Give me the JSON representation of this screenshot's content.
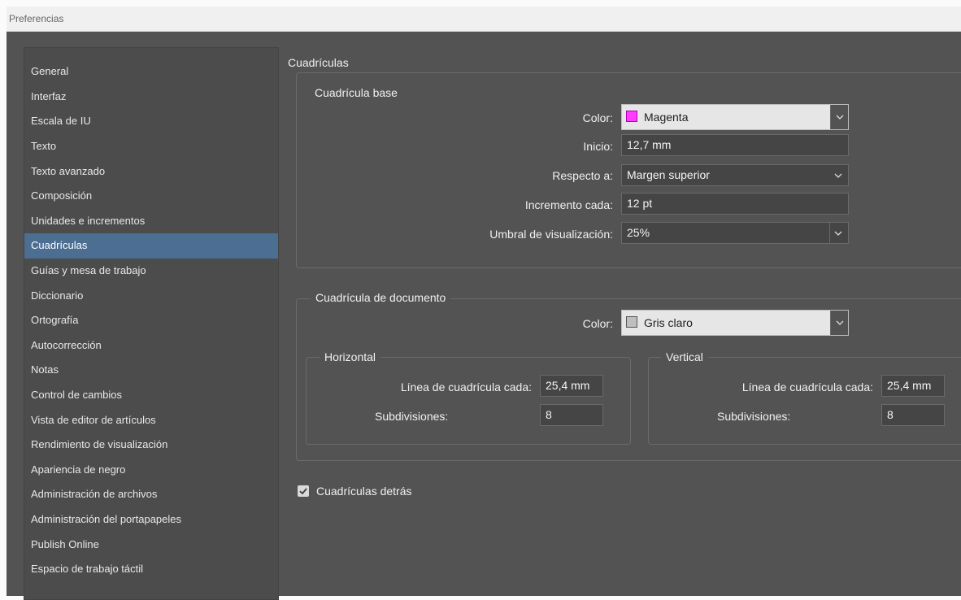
{
  "window": {
    "title": "Preferencias"
  },
  "sidebar": {
    "items": [
      {
        "label": "General"
      },
      {
        "label": "Interfaz"
      },
      {
        "label": "Escala de IU"
      },
      {
        "label": "Texto"
      },
      {
        "label": "Texto avanzado"
      },
      {
        "label": "Composición"
      },
      {
        "label": "Unidades e incrementos"
      },
      {
        "label": "Cuadrículas",
        "selected": true
      },
      {
        "label": "Guías y mesa de trabajo"
      },
      {
        "label": "Diccionario"
      },
      {
        "label": "Ortografía"
      },
      {
        "label": "Autocorrección"
      },
      {
        "label": "Notas"
      },
      {
        "label": "Control de cambios"
      },
      {
        "label": "Vista de editor de artículos"
      },
      {
        "label": "Rendimiento de visualización"
      },
      {
        "label": "Apariencia de negro"
      },
      {
        "label": "Administración de archivos"
      },
      {
        "label": "Administración del portapapeles"
      },
      {
        "label": "Publish Online"
      },
      {
        "label": "Espacio de trabajo táctil"
      }
    ]
  },
  "main": {
    "title": "Cuadrículas",
    "base_grid": {
      "legend": "Cuadrícula base",
      "color_label": "Color:",
      "color_value": "Magenta",
      "color_swatch": "#ff3cff",
      "start_label": "Inicio:",
      "start_value": "12,7 mm",
      "relative_label": "Respecto a:",
      "relative_value": "Margen superior",
      "increment_label": "Incremento cada:",
      "increment_value": "12 pt",
      "threshold_label": "Umbral de visualización:",
      "threshold_value": "25%"
    },
    "doc_grid": {
      "legend": "Cuadrícula de documento",
      "color_label": "Color:",
      "color_value": "Gris claro",
      "color_swatch": "#bfbfbf",
      "horizontal": {
        "legend": "Horizontal",
        "gridline_label": "Línea de cuadrícula cada:",
        "gridline_value": "25,4 mm",
        "subdiv_label": "Subdivisiones:",
        "subdiv_value": "8"
      },
      "vertical": {
        "legend": "Vertical",
        "gridline_label": "Línea de cuadrícula cada:",
        "gridline_value": "25,4 mm",
        "subdiv_label": "Subdivisiones:",
        "subdiv_value": "8"
      }
    },
    "grids_behind": {
      "label": "Cuadrículas detrás",
      "checked": true
    }
  }
}
